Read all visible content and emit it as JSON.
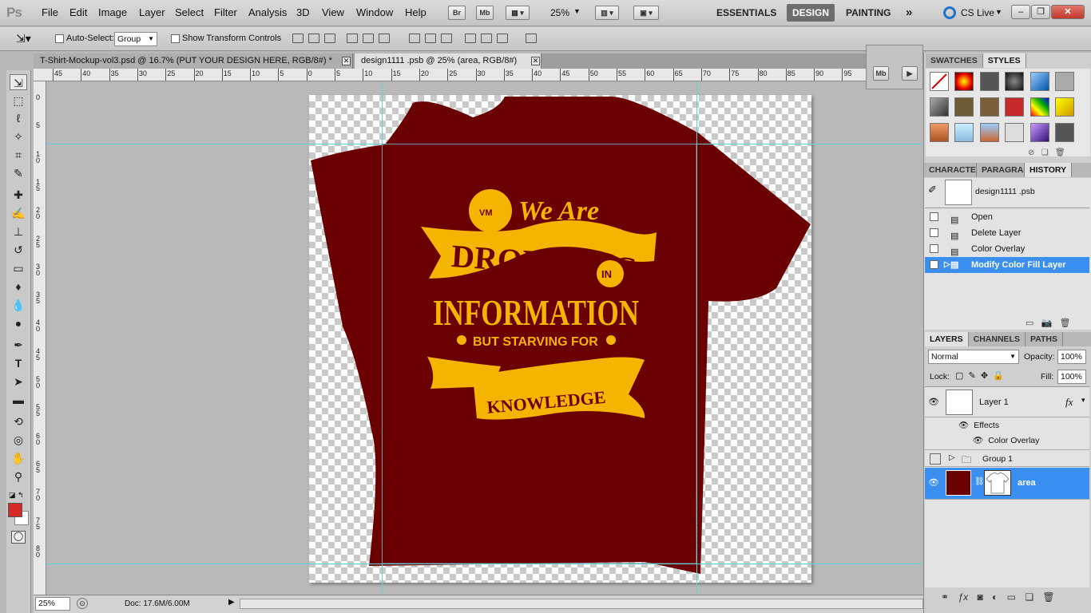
{
  "menu": {
    "logo": "Ps",
    "items": [
      "File",
      "Edit",
      "Image",
      "Layer",
      "Select",
      "Filter",
      "Analysis",
      "3D",
      "View",
      "Window",
      "Help"
    ],
    "bridge": "Br",
    "minibridge": "Mb",
    "zoom": "25%"
  },
  "workspaces": {
    "essentials": "ESSENTIALS",
    "design": "DESIGN",
    "painting": "PAINTING",
    "more": "»"
  },
  "cslive": "CS Live",
  "options": {
    "auto_select_label": "Auto-Select:",
    "auto_select_value": "Group",
    "transform_label": "Show Transform Controls"
  },
  "tabs": [
    {
      "label": "T-Shirt-Mockup-vol3.psd @ 16.7% (PUT YOUR DESIGN HERE, RGB/8#) *"
    },
    {
      "label": "design1111 .psb @ 25% (area, RGB/8#)"
    }
  ],
  "ruler": {
    "h": [
      "45",
      "40",
      "35",
      "30",
      "25",
      "20",
      "15",
      "10",
      "5",
      "0",
      "5",
      "10",
      "15",
      "20",
      "25",
      "30",
      "35",
      "40",
      "45",
      "50",
      "55",
      "60",
      "65",
      "70",
      "75",
      "80",
      "85",
      "90",
      "95"
    ],
    "v": [
      "0",
      "5",
      "1\n0",
      "1\n5",
      "2\n0",
      "2\n5",
      "3\n0",
      "3\n5",
      "4\n0",
      "4\n5",
      "5\n0",
      "5\n5",
      "6\n0",
      "6\n5",
      "7\n0",
      "7\n5",
      "8\n0"
    ]
  },
  "design": {
    "line1": "We Are",
    "line2": "DROWNING",
    "line3": "IN",
    "line4": "INFORMATION",
    "line5": "BUT STARVING FOR",
    "line6": "KNOWLEDGE",
    "shirt_color": "#6b0000",
    "ink_color": "#f5b400"
  },
  "status": {
    "zoom": "25%",
    "doc": "Doc: 17.6M/6.00M"
  },
  "swatches_panel": {
    "tabs": [
      "SWATCHES",
      "STYLES"
    ]
  },
  "history_panel": {
    "tabs": [
      "CHARACTER",
      "PARAGRAPH",
      "HISTORY"
    ],
    "snapshot": "design1111 .psb",
    "states": [
      "Open",
      "Delete Layer",
      "Color Overlay",
      "Modify Color Fill Layer"
    ]
  },
  "layers_panel": {
    "tabs": [
      "LAYERS",
      "CHANNELS",
      "PATHS"
    ],
    "blend": "Normal",
    "opacity_label": "Opacity:",
    "opacity": "100%",
    "lock_label": "Lock:",
    "fill_label": "Fill:",
    "fill": "100%",
    "layer1": "Layer 1",
    "effects": "Effects",
    "color_overlay": "Color Overlay",
    "group1": "Group 1",
    "area": "area",
    "fx": "fx"
  }
}
